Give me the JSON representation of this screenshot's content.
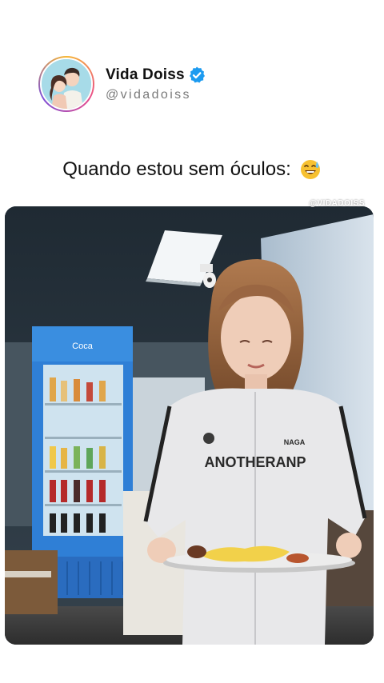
{
  "post": {
    "display_name": "Vida Doiss",
    "handle": "@vidadoiss",
    "verified": true,
    "caption": "Quando estou sem óculos:",
    "caption_emoji": "grinning-sweat-face-emoji"
  },
  "video": {
    "watermark": "@VIDADOISS",
    "jacket_text": "ANOTHERANP",
    "sticker_text": "NAGA",
    "fridge_label": "Coca"
  },
  "colors": {
    "verified_badge": "#1d9bf0",
    "text_primary": "#111111",
    "text_secondary": "#7a7a7a",
    "fridge_blue": "#2f7fd6"
  },
  "icons": {
    "verified": "verified-badge-icon",
    "caption_emoji": "sweat-smile-emoji"
  }
}
